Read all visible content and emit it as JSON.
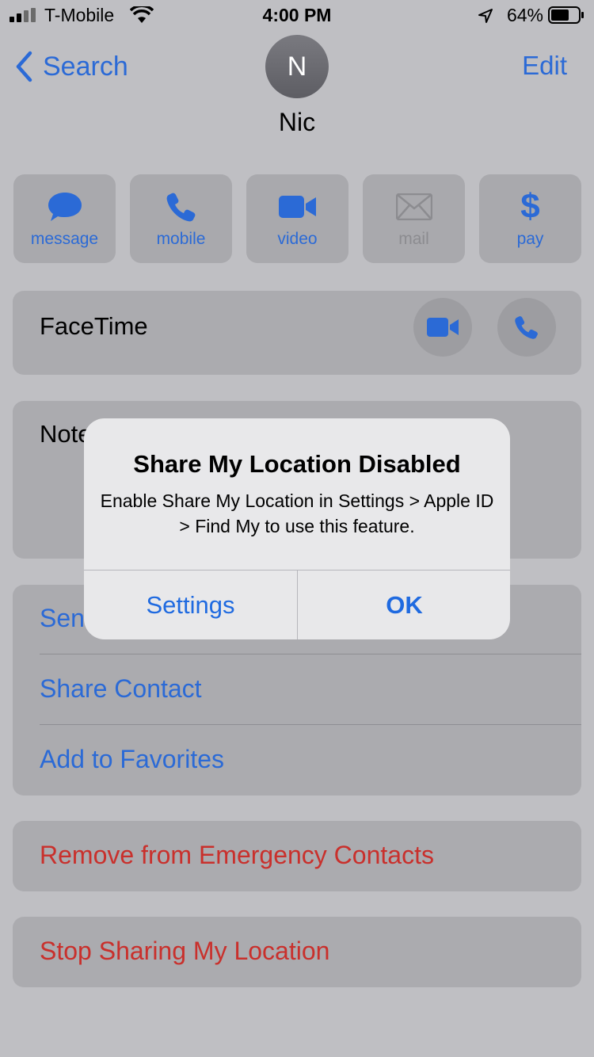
{
  "status_bar": {
    "carrier": "T-Mobile",
    "time": "4:00 PM",
    "battery": "64%"
  },
  "nav": {
    "back_label": "Search",
    "edit_label": "Edit"
  },
  "contact": {
    "initial": "N",
    "name": "Nic"
  },
  "actions": [
    {
      "label": "message",
      "icon": "message-bubble-icon",
      "enabled": true
    },
    {
      "label": "mobile",
      "icon": "phone-icon",
      "enabled": true
    },
    {
      "label": "video",
      "icon": "video-camera-icon",
      "enabled": true
    },
    {
      "label": "mail",
      "icon": "envelope-icon",
      "enabled": false
    },
    {
      "label": "pay",
      "icon": "dollar-icon",
      "enabled": true
    }
  ],
  "facetime": {
    "label": "FaceTime"
  },
  "notes": {
    "label": "Notes",
    "visible_text": "Note"
  },
  "options": {
    "send_partial": "Sen",
    "share_contact": "Share Contact",
    "add_favorites": "Add to Favorites"
  },
  "emergency": {
    "remove_label": "Remove from Emergency Contacts"
  },
  "location": {
    "stop_label": "Stop Sharing My Location"
  },
  "alert": {
    "title": "Share My Location Disabled",
    "message": "Enable Share My Location in Settings > Apple ID > Find My to use this feature.",
    "settings_label": "Settings",
    "ok_label": "OK"
  },
  "colors": {
    "accent": "#2b6ad6",
    "destructive": "#c9302c",
    "dim_background": "#bfbfc3"
  }
}
